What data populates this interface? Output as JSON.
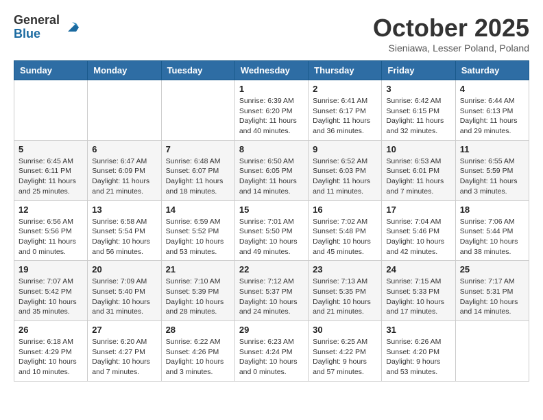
{
  "header": {
    "logo_general": "General",
    "logo_blue": "Blue",
    "month_title": "October 2025",
    "location": "Sieniawa, Lesser Poland, Poland"
  },
  "weekdays": [
    "Sunday",
    "Monday",
    "Tuesday",
    "Wednesday",
    "Thursday",
    "Friday",
    "Saturday"
  ],
  "weeks": [
    [
      {
        "day": "",
        "info": ""
      },
      {
        "day": "",
        "info": ""
      },
      {
        "day": "",
        "info": ""
      },
      {
        "day": "1",
        "info": "Sunrise: 6:39 AM\nSunset: 6:20 PM\nDaylight: 11 hours\nand 40 minutes."
      },
      {
        "day": "2",
        "info": "Sunrise: 6:41 AM\nSunset: 6:17 PM\nDaylight: 11 hours\nand 36 minutes."
      },
      {
        "day": "3",
        "info": "Sunrise: 6:42 AM\nSunset: 6:15 PM\nDaylight: 11 hours\nand 32 minutes."
      },
      {
        "day": "4",
        "info": "Sunrise: 6:44 AM\nSunset: 6:13 PM\nDaylight: 11 hours\nand 29 minutes."
      }
    ],
    [
      {
        "day": "5",
        "info": "Sunrise: 6:45 AM\nSunset: 6:11 PM\nDaylight: 11 hours\nand 25 minutes."
      },
      {
        "day": "6",
        "info": "Sunrise: 6:47 AM\nSunset: 6:09 PM\nDaylight: 11 hours\nand 21 minutes."
      },
      {
        "day": "7",
        "info": "Sunrise: 6:48 AM\nSunset: 6:07 PM\nDaylight: 11 hours\nand 18 minutes."
      },
      {
        "day": "8",
        "info": "Sunrise: 6:50 AM\nSunset: 6:05 PM\nDaylight: 11 hours\nand 14 minutes."
      },
      {
        "day": "9",
        "info": "Sunrise: 6:52 AM\nSunset: 6:03 PM\nDaylight: 11 hours\nand 11 minutes."
      },
      {
        "day": "10",
        "info": "Sunrise: 6:53 AM\nSunset: 6:01 PM\nDaylight: 11 hours\nand 7 minutes."
      },
      {
        "day": "11",
        "info": "Sunrise: 6:55 AM\nSunset: 5:59 PM\nDaylight: 11 hours\nand 3 minutes."
      }
    ],
    [
      {
        "day": "12",
        "info": "Sunrise: 6:56 AM\nSunset: 5:56 PM\nDaylight: 11 hours\nand 0 minutes."
      },
      {
        "day": "13",
        "info": "Sunrise: 6:58 AM\nSunset: 5:54 PM\nDaylight: 10 hours\nand 56 minutes."
      },
      {
        "day": "14",
        "info": "Sunrise: 6:59 AM\nSunset: 5:52 PM\nDaylight: 10 hours\nand 53 minutes."
      },
      {
        "day": "15",
        "info": "Sunrise: 7:01 AM\nSunset: 5:50 PM\nDaylight: 10 hours\nand 49 minutes."
      },
      {
        "day": "16",
        "info": "Sunrise: 7:02 AM\nSunset: 5:48 PM\nDaylight: 10 hours\nand 45 minutes."
      },
      {
        "day": "17",
        "info": "Sunrise: 7:04 AM\nSunset: 5:46 PM\nDaylight: 10 hours\nand 42 minutes."
      },
      {
        "day": "18",
        "info": "Sunrise: 7:06 AM\nSunset: 5:44 PM\nDaylight: 10 hours\nand 38 minutes."
      }
    ],
    [
      {
        "day": "19",
        "info": "Sunrise: 7:07 AM\nSunset: 5:42 PM\nDaylight: 10 hours\nand 35 minutes."
      },
      {
        "day": "20",
        "info": "Sunrise: 7:09 AM\nSunset: 5:40 PM\nDaylight: 10 hours\nand 31 minutes."
      },
      {
        "day": "21",
        "info": "Sunrise: 7:10 AM\nSunset: 5:39 PM\nDaylight: 10 hours\nand 28 minutes."
      },
      {
        "day": "22",
        "info": "Sunrise: 7:12 AM\nSunset: 5:37 PM\nDaylight: 10 hours\nand 24 minutes."
      },
      {
        "day": "23",
        "info": "Sunrise: 7:13 AM\nSunset: 5:35 PM\nDaylight: 10 hours\nand 21 minutes."
      },
      {
        "day": "24",
        "info": "Sunrise: 7:15 AM\nSunset: 5:33 PM\nDaylight: 10 hours\nand 17 minutes."
      },
      {
        "day": "25",
        "info": "Sunrise: 7:17 AM\nSunset: 5:31 PM\nDaylight: 10 hours\nand 14 minutes."
      }
    ],
    [
      {
        "day": "26",
        "info": "Sunrise: 6:18 AM\nSunset: 4:29 PM\nDaylight: 10 hours\nand 10 minutes."
      },
      {
        "day": "27",
        "info": "Sunrise: 6:20 AM\nSunset: 4:27 PM\nDaylight: 10 hours\nand 7 minutes."
      },
      {
        "day": "28",
        "info": "Sunrise: 6:22 AM\nSunset: 4:26 PM\nDaylight: 10 hours\nand 3 minutes."
      },
      {
        "day": "29",
        "info": "Sunrise: 6:23 AM\nSunset: 4:24 PM\nDaylight: 10 hours\nand 0 minutes."
      },
      {
        "day": "30",
        "info": "Sunrise: 6:25 AM\nSunset: 4:22 PM\nDaylight: 9 hours\nand 57 minutes."
      },
      {
        "day": "31",
        "info": "Sunrise: 6:26 AM\nSunset: 4:20 PM\nDaylight: 9 hours\nand 53 minutes."
      },
      {
        "day": "",
        "info": ""
      }
    ]
  ]
}
